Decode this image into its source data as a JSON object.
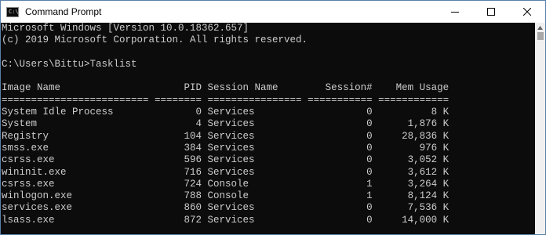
{
  "window": {
    "title": "Command Prompt",
    "icon_text": "C:\\"
  },
  "console": {
    "header": [
      "Microsoft Windows [Version 10.0.18362.657]",
      "(c) 2019 Microsoft Corporation. All rights reserved.",
      "",
      "C:\\Users\\Bittu>Tasklist",
      ""
    ],
    "table_header": "Image Name                     PID Session Name        Session#    Mem Usage",
    "table_separator": "========================= ======== ================ =========== ============",
    "columns": [
      "Image Name",
      "PID",
      "Session Name",
      "Session#",
      "Mem Usage"
    ],
    "rows": [
      {
        "image": "System Idle Process",
        "pid": "0",
        "session": "Services",
        "num": "0",
        "mem": "8 K"
      },
      {
        "image": "System",
        "pid": "4",
        "session": "Services",
        "num": "0",
        "mem": "1,876 K"
      },
      {
        "image": "Registry",
        "pid": "104",
        "session": "Services",
        "num": "0",
        "mem": "28,836 K"
      },
      {
        "image": "smss.exe",
        "pid": "384",
        "session": "Services",
        "num": "0",
        "mem": "976 K"
      },
      {
        "image": "csrss.exe",
        "pid": "596",
        "session": "Services",
        "num": "0",
        "mem": "3,052 K"
      },
      {
        "image": "wininit.exe",
        "pid": "716",
        "session": "Services",
        "num": "0",
        "mem": "3,612 K"
      },
      {
        "image": "csrss.exe",
        "pid": "724",
        "session": "Console",
        "num": "1",
        "mem": "3,264 K"
      },
      {
        "image": "winlogon.exe",
        "pid": "788",
        "session": "Console",
        "num": "1",
        "mem": "8,124 K"
      },
      {
        "image": "services.exe",
        "pid": "860",
        "session": "Services",
        "num": "0",
        "mem": "7,536 K"
      },
      {
        "image": "lsass.exe",
        "pid": "872",
        "session": "Services",
        "num": "0",
        "mem": "14,000 K"
      }
    ]
  },
  "colors": {
    "console_bg": "#0c0c0c",
    "console_text": "#cccccc",
    "titlebar_bg": "#ffffff"
  },
  "icons": {
    "app": "console-icon",
    "minimize": "minimize-icon",
    "maximize": "maximize-icon",
    "close": "close-icon",
    "scroll_up": "scroll-up-icon"
  }
}
